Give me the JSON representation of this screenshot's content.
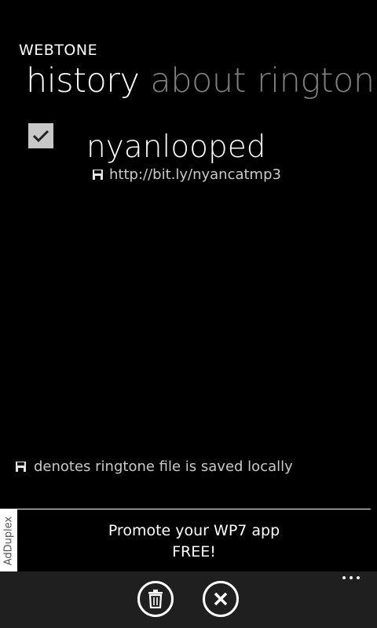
{
  "app": {
    "title": "WEBTONE"
  },
  "pivot": {
    "items": [
      "history",
      "about",
      "ringtone"
    ],
    "selected": "history"
  },
  "history": {
    "items": [
      {
        "checked": true,
        "title": "nyanlooped",
        "url": "http://bit.ly/nyancatmp3",
        "saved_icon": "floppy-disk-icon"
      }
    ]
  },
  "legend": {
    "icon": "floppy-disk-icon",
    "text": "denotes ringtone file is saved locally"
  },
  "ad": {
    "provider": "AdDuplex",
    "line1": "Promote your WP7 app",
    "line2": "FREE!"
  },
  "appbar": {
    "buttons": [
      "trash-icon",
      "close-icon"
    ],
    "more_icon": "ellipsis-icon"
  },
  "colors": {
    "background": "#000000",
    "appbar": "#1f1f1f",
    "inactive_pivot": "#808080",
    "checkbox": "#c8c8c8"
  }
}
